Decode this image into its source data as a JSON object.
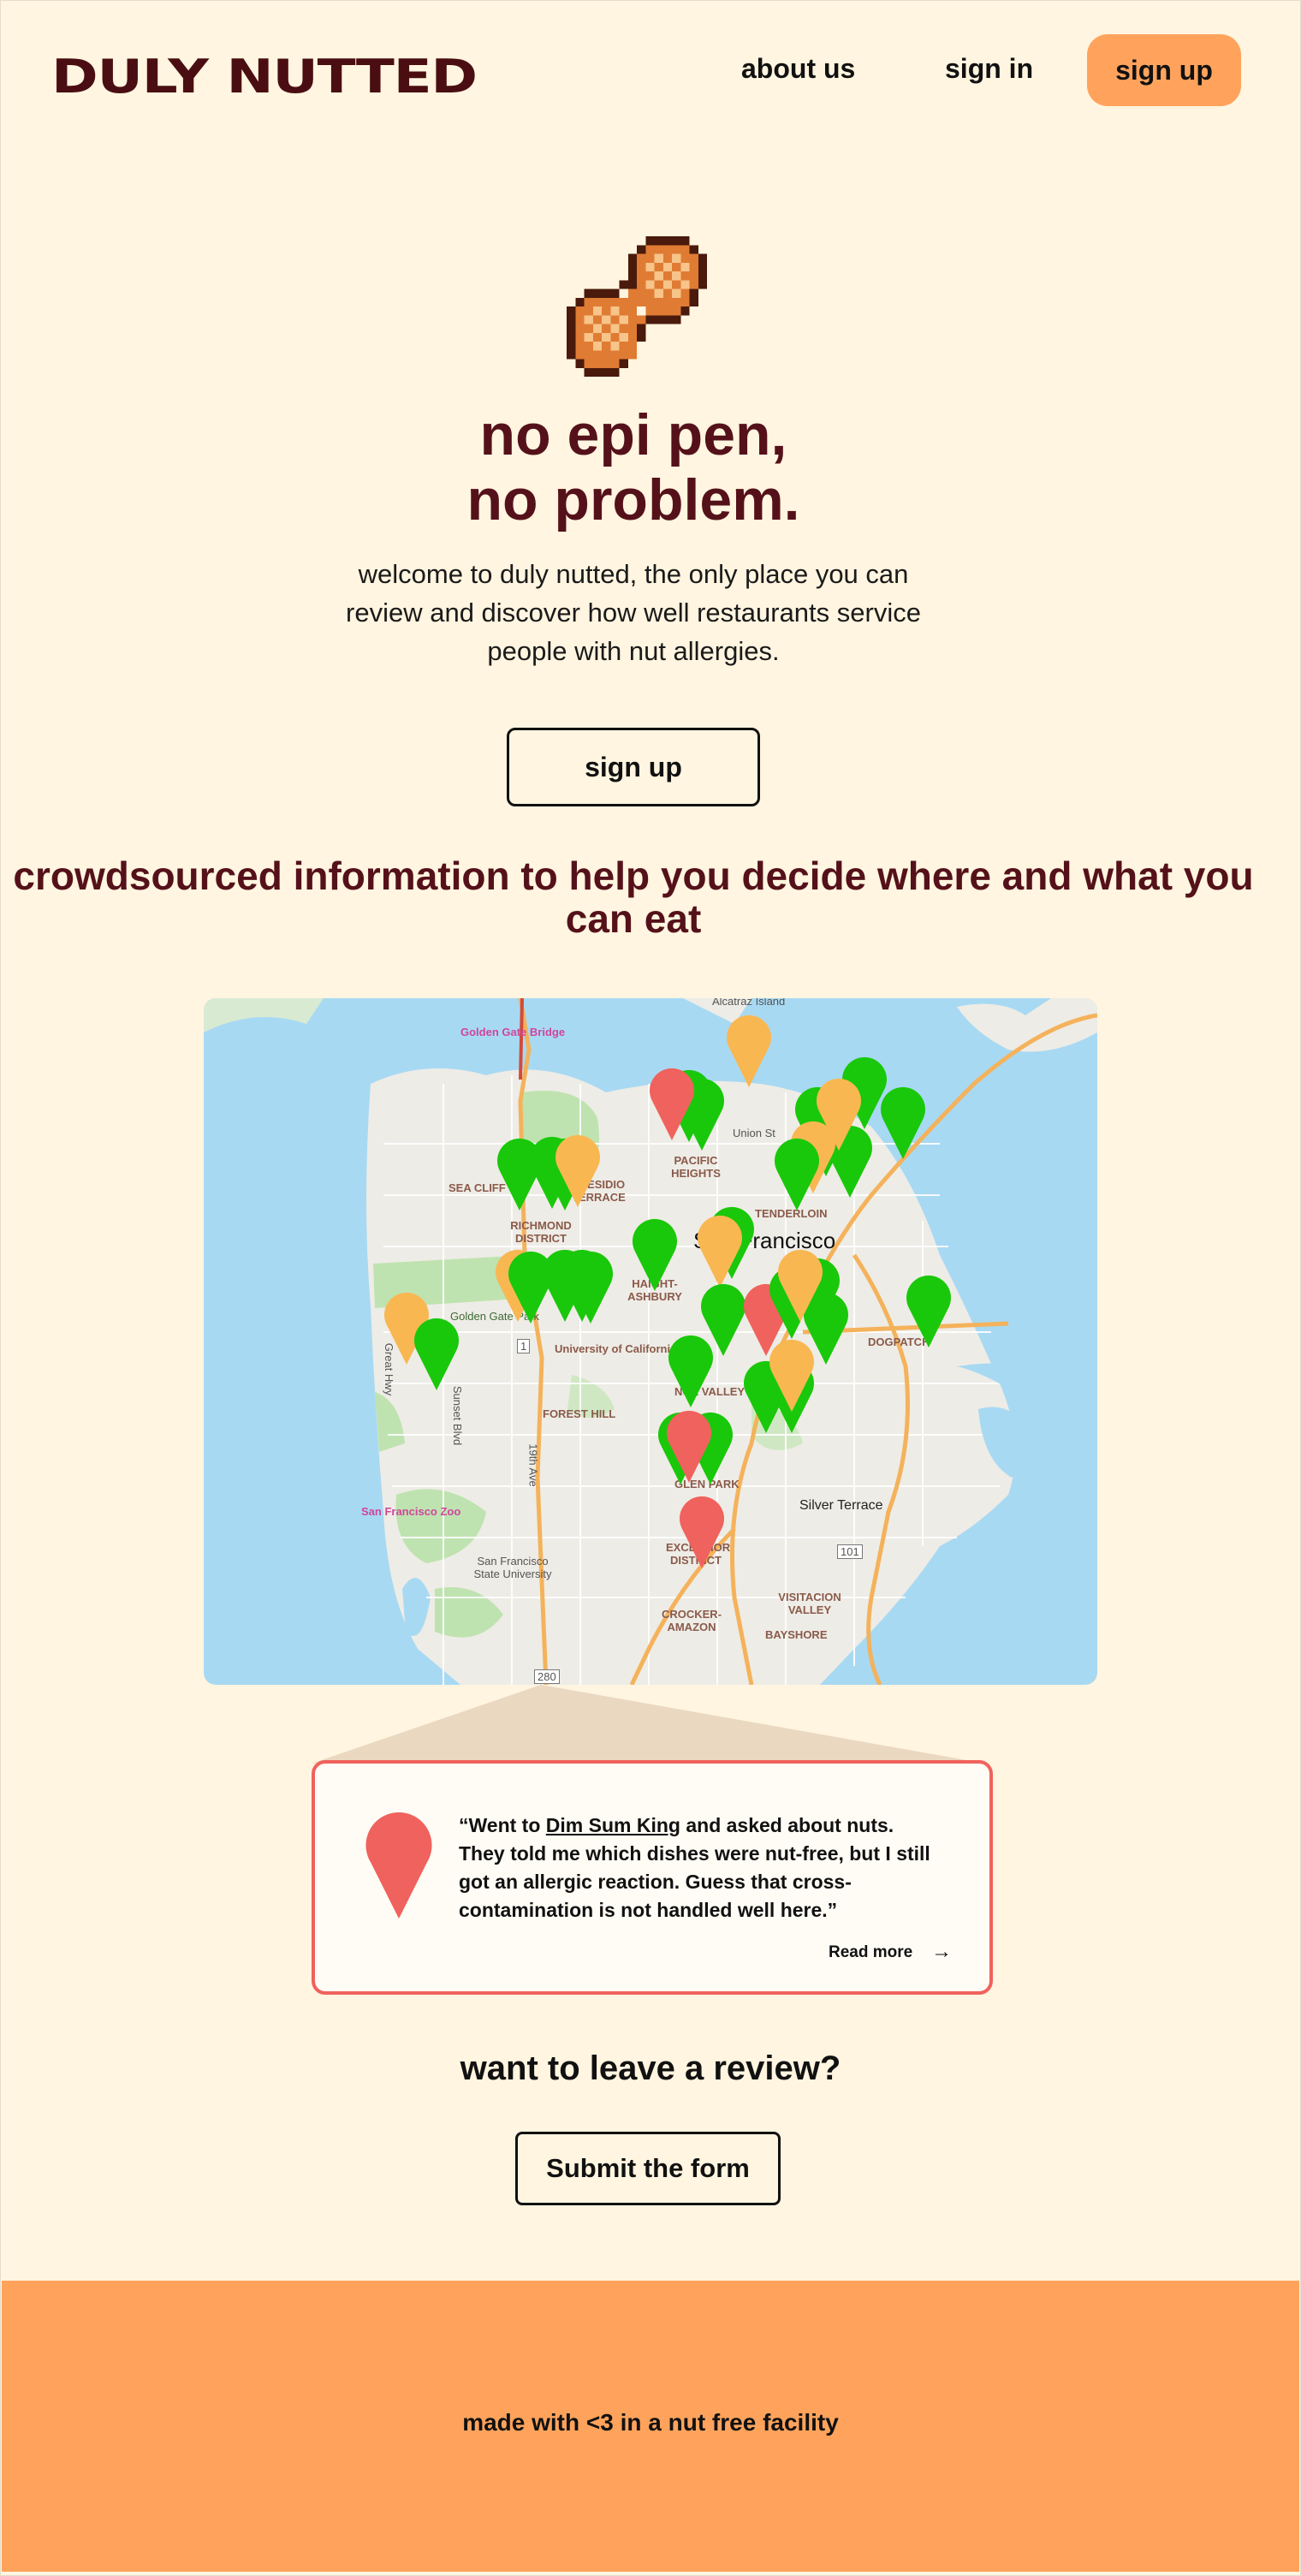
{
  "header": {
    "logo": "DULY NUTTED",
    "nav": {
      "about": "about us",
      "signin": "sign in",
      "signup": "sign up"
    }
  },
  "hero": {
    "title_line1": "no epi pen,",
    "title_line2": "no problem.",
    "subtitle": "welcome to duly nutted, the only place you can review and discover how well restaurants service people with nut allergies.",
    "signup_label": "sign up"
  },
  "map_section": {
    "title": "crowdsourced information to help you decide where and what you can eat",
    "labels": {
      "alcatraz": "Alcatraz Island",
      "golden_gate": "Golden Gate Bridge",
      "union_st": "Union St",
      "pacific_heights": "PACIFIC HEIGHTS",
      "sea_cliff": "SEA CLIFF",
      "presidio_terrace": "PRESIDIO TERRACE",
      "richmond": "RICHMOND DISTRICT",
      "tenderloin": "TENDERLOIN",
      "city": "San Francisco",
      "haight": "HAIGHT-ASHBURY",
      "golden_gate_park": "Golden Gate Park",
      "ucsf": "University of California",
      "great_hwy": "Great Hwy",
      "sunset": "Sunset Blvd",
      "forest_hill": "FOREST HILL",
      "nineteenth": "19th Ave",
      "dogpatch": "DOGPATCH",
      "noe_valley": "NOE VALLEY",
      "glen_park": "GLEN PARK",
      "silver_terrace": "Silver Terrace",
      "zoo": "San Francisco Zoo",
      "sfsu": "San Francisco State University",
      "excelsior": "EXCELSIOR DISTRICT",
      "visitacion": "VISITACION VALLEY",
      "crocker": "CROCKER-AMAZON",
      "bayshore": "BAYSHORE",
      "hwy101": "101",
      "hwy280": "280",
      "hwy1": "1"
    },
    "legend_colors": {
      "good": "#19c80a",
      "mixed": "#f9b752",
      "bad": "#f0625d"
    }
  },
  "review": {
    "quote_start": "“Went to ",
    "restaurant": "Dim Sum King",
    "quote_end": " and asked about nuts. They told me which dishes were nut-free, but I still got an allergic reaction. Guess that cross-contamination is not handled well here.”",
    "read_more": "Read more",
    "arrow": "→"
  },
  "cta": {
    "title": "want to leave a review?",
    "button": "Submit the form"
  },
  "footer": {
    "text": "made with <3 in a nut free facility"
  }
}
